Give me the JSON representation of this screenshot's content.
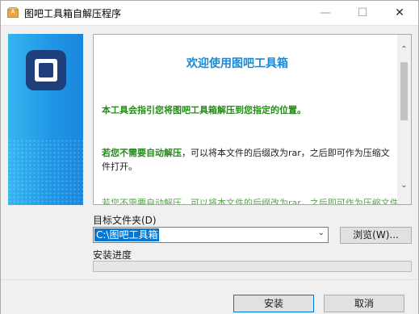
{
  "window": {
    "title": "图吧工具箱自解压程序",
    "controls": {
      "minimize": "—",
      "maximize": "☐",
      "close": "✕"
    }
  },
  "info": {
    "heading": "欢迎使用图吧工具箱",
    "line1": "本工具会指引您将图吧工具箱解压到您指定的位置。",
    "para_green": "若您不需要自动解压",
    "para_rest": "，可以将本文件的后缀改为rar，之后即可作为压缩文件打开。",
    "cut_line": "若您不需要自动解压，可以将本文件的后缀改为rar，之后即可作为压缩文件打开。",
    "scroll_up": "⌃",
    "scroll_down": "⌄"
  },
  "folder": {
    "label": "目标文件夹(D)",
    "value": "C:\\图吧工具箱",
    "chevron": "⌄",
    "browse_label": "浏览(W)..."
  },
  "progress": {
    "label": "安装进度",
    "value": 0
  },
  "buttons": {
    "install": "安装",
    "cancel": "取消"
  },
  "colors": {
    "accent": "#0078d7",
    "heading": "#1a89d6",
    "green_text": "#248a19",
    "banner": "#1f98e6",
    "logo": "#1e3f7a"
  },
  "icons": {
    "app": "package-icon",
    "logo": "tuba-logo-icon"
  }
}
